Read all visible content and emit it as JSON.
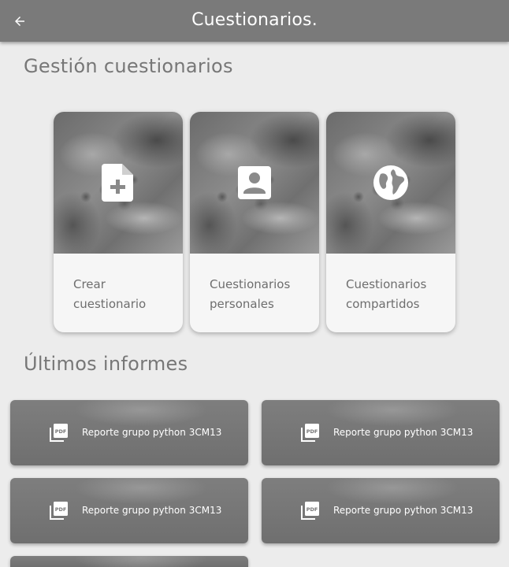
{
  "appbar": {
    "title": "Cuestionarios.",
    "back_icon": "arrow-left-icon"
  },
  "gestion": {
    "title": "Gestión cuestionarios",
    "cards": [
      {
        "line1": "Crear",
        "line2": "cuestionario",
        "icon": "file-plus-icon"
      },
      {
        "line1": "Cuestionarios",
        "line2": "personales",
        "icon": "account-box-icon"
      },
      {
        "line1": "Cuestionarios",
        "line2": "compartidos",
        "icon": "globe-icon"
      }
    ]
  },
  "informes": {
    "title": "Últimos informes",
    "reports": [
      {
        "label": "Reporte grupo python 3CM13",
        "icon": "pdf-icon"
      },
      {
        "label": "Reporte grupo python 3CM13",
        "icon": "pdf-icon"
      },
      {
        "label": "Reporte grupo python 3CM13",
        "icon": "pdf-icon"
      },
      {
        "label": "Reporte grupo python 3CM13",
        "icon": "pdf-icon"
      },
      {
        "label": "",
        "icon": ""
      }
    ]
  },
  "colors": {
    "appbar": "#7a7a7a",
    "background": "#ececec",
    "card": "#f6f6f6",
    "report": "#777777",
    "heading_text": "#777777"
  }
}
